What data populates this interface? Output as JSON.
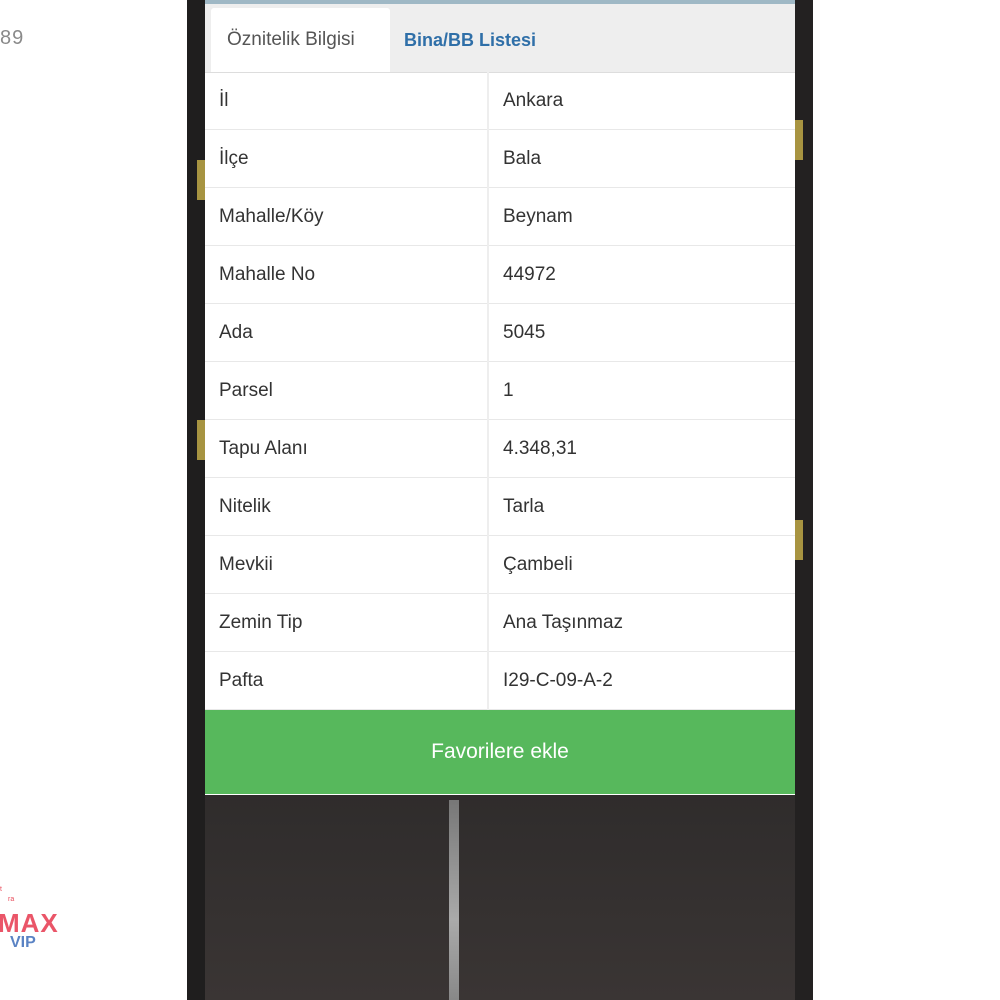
{
  "left": {
    "partial_number": "89"
  },
  "logo": {
    "tiny_top": "t",
    "tiny_sub": "ra",
    "max": "MAX",
    "vip": "VIP"
  },
  "tabs": [
    {
      "label": "Öznitelik Bilgisi",
      "active": true
    },
    {
      "label": "Bina/BB Listesi",
      "active": false
    }
  ],
  "rows": [
    {
      "key": "İl",
      "value": "Ankara"
    },
    {
      "key": "İlçe",
      "value": "Bala"
    },
    {
      "key": "Mahalle/Köy",
      "value": "Beynam"
    },
    {
      "key": "Mahalle No",
      "value": "44972"
    },
    {
      "key": "Ada",
      "value": "5045"
    },
    {
      "key": "Parsel",
      "value": "1"
    },
    {
      "key": "Tapu Alanı",
      "value": "4.348,31"
    },
    {
      "key": "Nitelik",
      "value": "Tarla"
    },
    {
      "key": "Mevkii",
      "value": "Çambeli"
    },
    {
      "key": "Zemin Tip",
      "value": "Ana Taşınmaz"
    },
    {
      "key": "Pafta",
      "value": "I29-C-09-A-2"
    }
  ],
  "favorite_button": {
    "label": "Favorilere ekle"
  },
  "colors": {
    "button_green": "#57b85c",
    "tab_link_blue": "#2f6fa8"
  }
}
